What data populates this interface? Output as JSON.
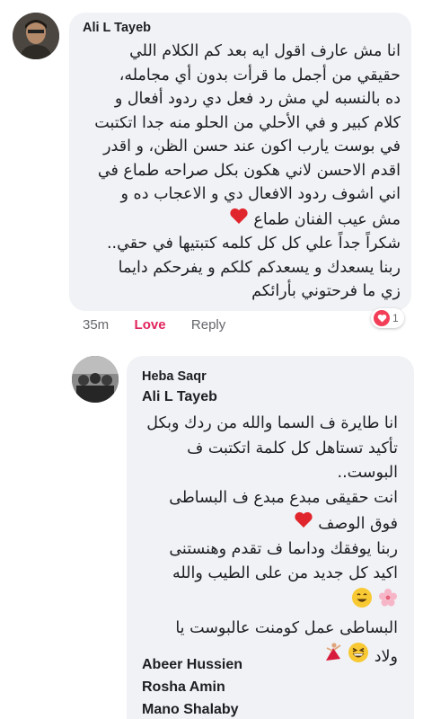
{
  "comment1": {
    "author": "Ali L Tayeb",
    "lines": [
      "انا مش عارف اقول ايه بعد كم الكلام اللي",
      "حقيقي من أجمل ما قرأت بدون أي مجامله،",
      "ده بالنسبه لي مش رد فعل دي ردود أفعال و",
      "كلام كبير و في الأحلي من الحلو منه جدا اتكتبت",
      "في بوست يارب اكون عند حسن الظن، و اقدر",
      "اقدم الاحسن لاني هكون بكل صراحه طماع في",
      "اني اشوف ردود الافعال دي و الاعجاب ده و",
      "مش عيب الفنان طماع",
      "شكراً جداً علي كل كل كلمه كتبتيها في حقي..",
      "ربنا يسعدك و يسعدكم كلكم و يفرحكم دايما",
      "زي ما فرحتوني بأرائكم"
    ],
    "time": "35m",
    "love_label": "Love",
    "reply_label": "Reply",
    "reaction_count": "1",
    "heart_color": "#f33e58"
  },
  "comment2": {
    "author": "Heba Saqr",
    "mention": "Ali L Tayeb",
    "lines": [
      "انا طايرة ف السما والله من ردك وبكل",
      "تأكيد تستاهل كل كلمة اتكتبت ف",
      "البوست..",
      "انت حقيقى مبدع مبدع ف البساطى",
      "فوق الوصف",
      "ربنا يوفقك وداىما ف تقدم وهنستنى",
      "اكيد كل جديد من على الطيب والله",
      "",
      "البساطى عمل كومنت عالبوست يا",
      "ولاد"
    ],
    "tags": [
      "Abeer Hussien",
      "Rosha Amin",
      "Mano Shalaby"
    ]
  }
}
